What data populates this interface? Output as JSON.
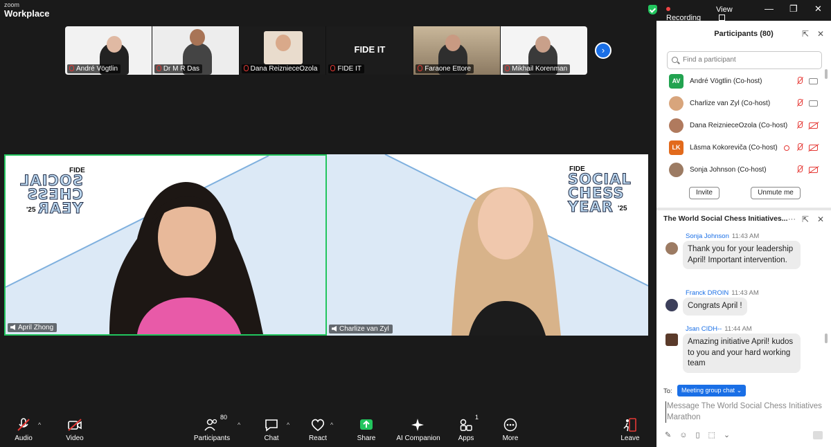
{
  "window": {
    "brand_top": "zoom",
    "brand_main": "Workplace",
    "recording_label": "Recording",
    "view_label": "View",
    "minimize": "—",
    "restore": "❐",
    "close": "✕"
  },
  "thumbnails": [
    {
      "name": "André Vögtlin"
    },
    {
      "name": "Dr M R Das"
    },
    {
      "name": "Dana ReizniecеOzola"
    },
    {
      "name": "FIDE IT",
      "caption": "FIDE IT"
    },
    {
      "name": "Faraone Ettore"
    },
    {
      "name": "Mikhail Korenman"
    }
  ],
  "main_tiles": {
    "left": {
      "name": "April Zhong",
      "logo_fide": "FIDE",
      "logo_lines": [
        "SOCIAL",
        "CHESS",
        "YEAR"
      ],
      "logo_year": "'25"
    },
    "right": {
      "name": "Charlize van Zyl",
      "logo_fide": "FIDE",
      "logo_lines": [
        "SOCIAL",
        "CHESS",
        "YEAR"
      ],
      "logo_year": "'25"
    }
  },
  "toolbar": {
    "audio": "Audio",
    "video": "Video",
    "participants": "Participants",
    "participants_count": "80",
    "chat": "Chat",
    "react": "React",
    "share": "Share",
    "ai_companion": "AI Companion",
    "apps": "Apps",
    "apps_count": "1",
    "more": "More",
    "leave": "Leave"
  },
  "participants_panel": {
    "title": "Participants (80)",
    "search_placeholder": "Find a participant",
    "invite": "Invite",
    "unmute_me": "Unmute me",
    "people": [
      {
        "name": "André Vögtlin (Co-host)",
        "initials": "AV",
        "color": "#22a350"
      },
      {
        "name": "Charlize van Zyl (Co-host)",
        "initials": "",
        "color": "#d8a57c"
      },
      {
        "name": "Dana ReizniecеOzola (Co-host)",
        "initials": "",
        "color": "#b07a5e"
      },
      {
        "name": "Lāsma Kokoreviča (Co-host)",
        "initials": "LK",
        "color": "#e26a1c"
      },
      {
        "name": "Sonja Johnson (Co-host)",
        "initials": "",
        "color": "#9c7b63"
      }
    ]
  },
  "chat_panel": {
    "title": "The World Social Chess Initiatives...",
    "messages": [
      {
        "sender": "Sonja Johnson",
        "time": "11:43 AM",
        "text": "Thank you for your leadership April! Important intervention."
      },
      {
        "sender": "Franck DROIN",
        "time": "11:43 AM",
        "text": "Congrats April !"
      },
      {
        "sender": "Jsan CIDH--",
        "time": "11:44 AM",
        "text": "Amazing initiative April! kudos to you and your hard working team"
      }
    ],
    "to_label": "To:",
    "to_value": "Meeting group chat",
    "compose_placeholder": "Message The World Social Chess Initiatives Marathon"
  },
  "colors": {
    "accent": "#1a6fe6",
    "active_speaker": "#22c55e",
    "muted": "#e53935"
  }
}
